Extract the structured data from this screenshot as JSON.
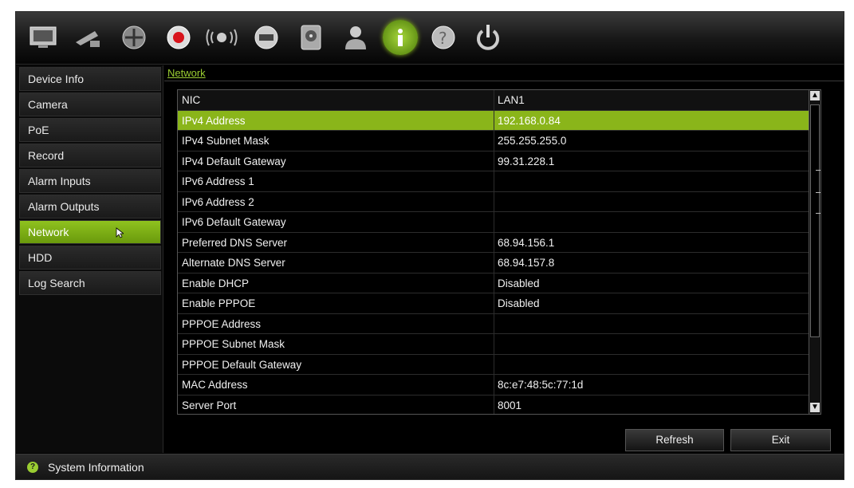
{
  "sidebar": {
    "items": [
      {
        "label": "Device Info"
      },
      {
        "label": "Camera"
      },
      {
        "label": "PoE"
      },
      {
        "label": "Record"
      },
      {
        "label": "Alarm Inputs"
      },
      {
        "label": "Alarm Outputs"
      },
      {
        "label": "Network",
        "active": true
      },
      {
        "label": "HDD"
      },
      {
        "label": "Log Search"
      }
    ]
  },
  "toolbar": {
    "icons": [
      "monitor-icon",
      "camera-icon",
      "ptz-icon",
      "record-icon",
      "alarm-icon",
      "network-device-icon",
      "hdd-icon",
      "user-icon",
      "info-icon",
      "help-icon",
      "power-icon"
    ],
    "active": "info-icon",
    "accent": "#8ab51a"
  },
  "breadcrumb": "Network",
  "table": {
    "header": {
      "key": "NIC",
      "value": "LAN1"
    },
    "rows": [
      {
        "key": "IPv4 Address",
        "value": "192.168.0.84",
        "selected": true
      },
      {
        "key": "IPv4 Subnet Mask",
        "value": "255.255.255.0"
      },
      {
        "key": "IPv4 Default Gateway",
        "value": "99.31.228.1"
      },
      {
        "key": "IPv6 Address 1",
        "value": ""
      },
      {
        "key": "IPv6 Address 2",
        "value": ""
      },
      {
        "key": "IPv6 Default Gateway",
        "value": ""
      },
      {
        "key": "Preferred DNS Server",
        "value": "68.94.156.1"
      },
      {
        "key": "Alternate DNS Server",
        "value": "68.94.157.8"
      },
      {
        "key": "Enable DHCP",
        "value": "Disabled"
      },
      {
        "key": "Enable PPPOE",
        "value": "Disabled"
      },
      {
        "key": "PPPOE Address",
        "value": ""
      },
      {
        "key": "PPPOE Subnet Mask",
        "value": ""
      },
      {
        "key": "PPPOE Default Gateway",
        "value": ""
      },
      {
        "key": "MAC Address",
        "value": "8c:e7:48:5c:77:1d"
      },
      {
        "key": "Server Port",
        "value": "8001"
      }
    ]
  },
  "buttons": {
    "refresh": "Refresh",
    "exit": "Exit"
  },
  "status": {
    "text": "System Information"
  }
}
